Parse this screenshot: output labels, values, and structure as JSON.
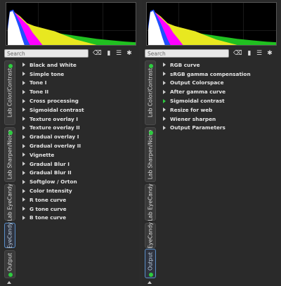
{
  "left_panel": {
    "search_placeholder": "Search",
    "tabs": [
      {
        "label": "Lab Color/Contrast",
        "active": false
      },
      {
        "label": "Lab Sharpen/Noise",
        "active": false
      },
      {
        "label": "Lab EyeCandy",
        "active": false
      },
      {
        "label": "EyeCandy",
        "active": true
      },
      {
        "label": "Output",
        "active": false
      }
    ],
    "items": [
      "Black and White",
      "Simple tone",
      "Tone I",
      "Tone II",
      "Cross processing",
      "Sigmoidal contrast",
      "Texture overlay I",
      "Texture overlay II",
      "Gradual overlay I",
      "Gradual overlay II",
      "Vignette",
      "Gradual Blur I",
      "Gradual Blur II",
      "Softglow / Orton",
      "Color Intensity",
      "R tone curve",
      "G tone curve",
      "B tone curve"
    ]
  },
  "right_panel": {
    "search_placeholder": "Search",
    "tabs": [
      {
        "label": "Lab Color/Contrast",
        "active": false
      },
      {
        "label": "Lab Sharpen/Noise",
        "active": false
      },
      {
        "label": "Lab EyeCandy",
        "active": false
      },
      {
        "label": "EyeCandy",
        "active": false
      },
      {
        "label": "Output",
        "active": true
      }
    ],
    "items": [
      "RGB curve",
      "sRGB gamma compensation",
      "Output Colorspace",
      "After gamma curve",
      "Sigmoidal contrast",
      "Resize for web",
      "Wiener sharpen",
      "Output Parameters"
    ],
    "enabled_item": "Sigmoidal contrast"
  },
  "colors": {
    "enabled_dot": "#2ecc40",
    "active_tab_border": "#5b8fc8"
  },
  "icons": [
    "clear-search-icon",
    "bookmark-icon",
    "list-icon",
    "gear-icon"
  ]
}
